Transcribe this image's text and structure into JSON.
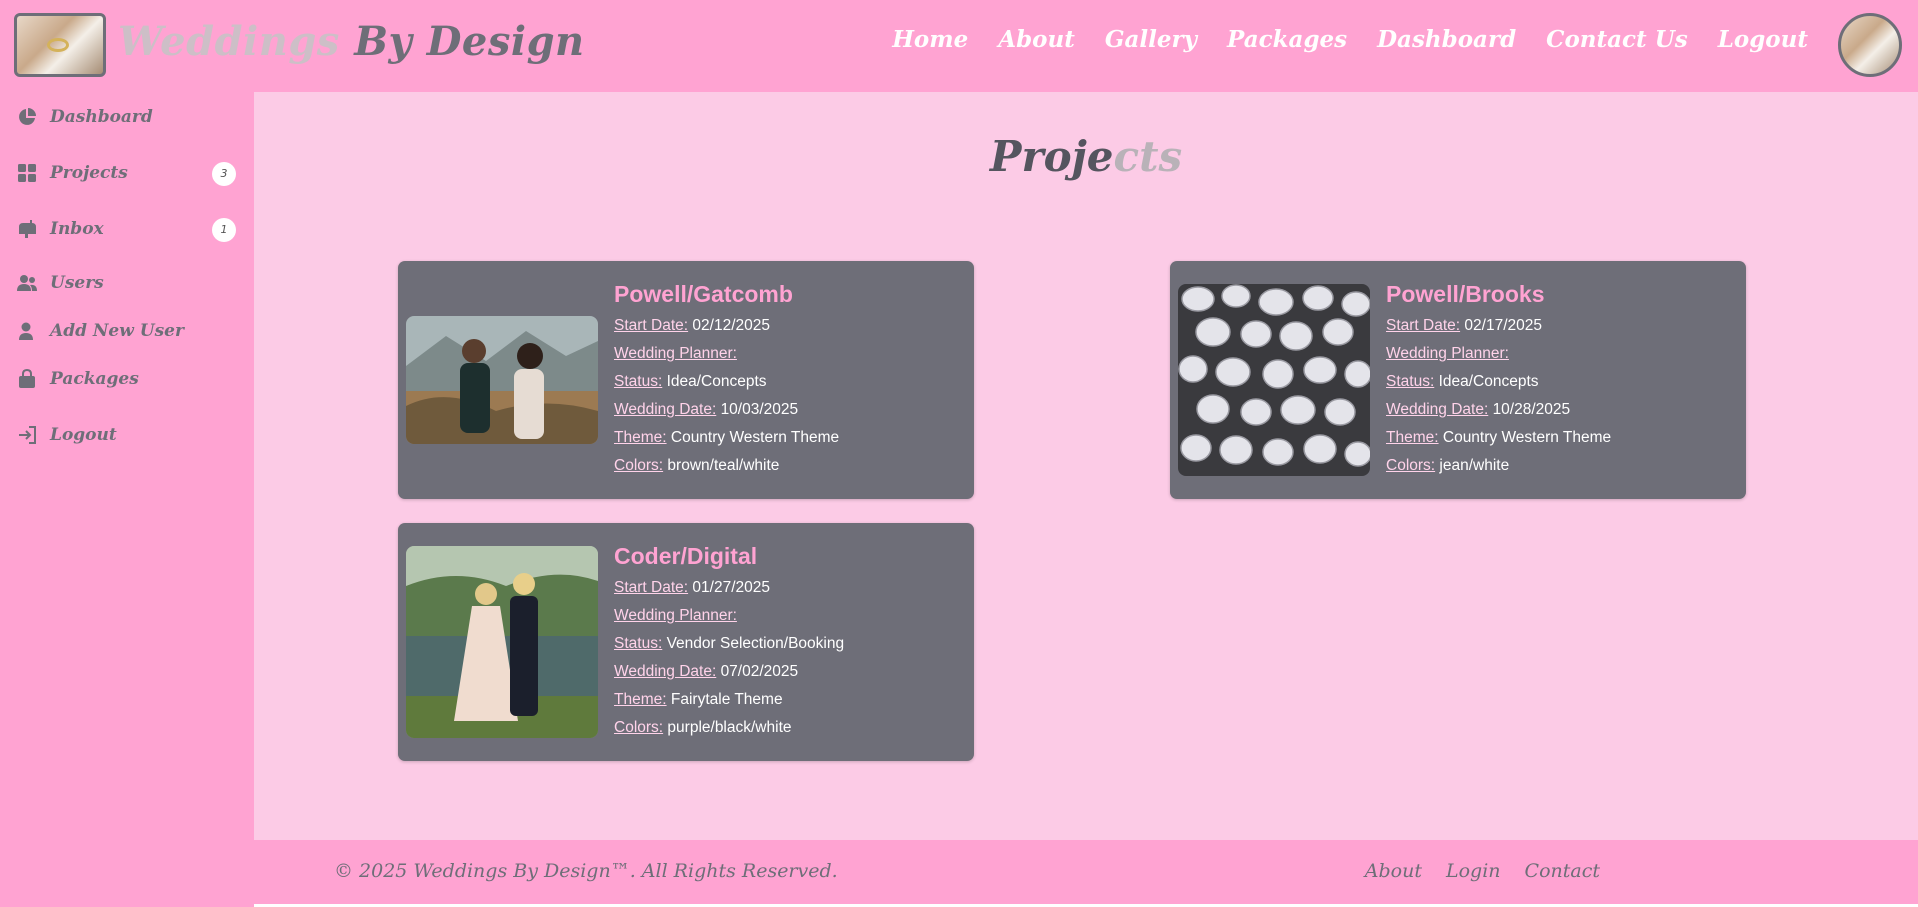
{
  "header": {
    "brand_part1": "Weddings",
    "brand_part2": " By Design",
    "nav": [
      "Home",
      "About",
      "Gallery",
      "Packages",
      "Dashboard",
      "Contact Us",
      "Logout"
    ]
  },
  "sidebar": {
    "items": [
      {
        "label": "Dashboard",
        "icon": "pie-chart-icon"
      },
      {
        "label": "Projects",
        "icon": "grid-icon",
        "badge": "3"
      },
      {
        "label": "Inbox",
        "icon": "mailbox-icon",
        "badge": "1"
      },
      {
        "label": "Users",
        "icon": "users-icon"
      },
      {
        "label": "Add New User",
        "icon": "user-icon"
      },
      {
        "label": "Packages",
        "icon": "bag-icon"
      },
      {
        "label": "Logout",
        "icon": "logout-icon"
      }
    ]
  },
  "main": {
    "title_part1": "Proje",
    "title_part2": "cts",
    "field_labels": {
      "start": "Start Date:",
      "planner": "Wedding Planner:",
      "status": "Status:",
      "wedding": "Wedding Date:",
      "theme": "Theme:",
      "colors": "Colors:"
    },
    "projects": [
      {
        "name": "Powell/Gatcomb",
        "start": "02/12/2025",
        "planner": "",
        "status": "Idea/Concepts",
        "wedding": "10/03/2025",
        "theme": "Country Western Theme",
        "colors": "brown/teal/white",
        "image": "couple-mountains-photo"
      },
      {
        "name": "Powell/Brooks",
        "start": "02/17/2025",
        "planner": "",
        "status": "Idea/Concepts",
        "wedding": "10/28/2025",
        "theme": "Country Western Theme",
        "colors": "jean/white",
        "image": "diamonds-photo"
      },
      {
        "name": "Coder/Digital",
        "start": "01/27/2025",
        "planner": "",
        "status": "Vendor Selection/Booking",
        "wedding": "07/02/2025",
        "theme": "Fairytale Theme",
        "colors": "purple/black/white",
        "image": "couple-lake-photo"
      }
    ]
  },
  "footer": {
    "copyright": "© 2025 Weddings By Design™. All Rights Reserved.",
    "links": [
      "About",
      "Login",
      "Contact"
    ]
  },
  "colors": {
    "pink": "#ffa3d2",
    "light_pink": "#fccbe6",
    "gray": "#6e6e78"
  }
}
